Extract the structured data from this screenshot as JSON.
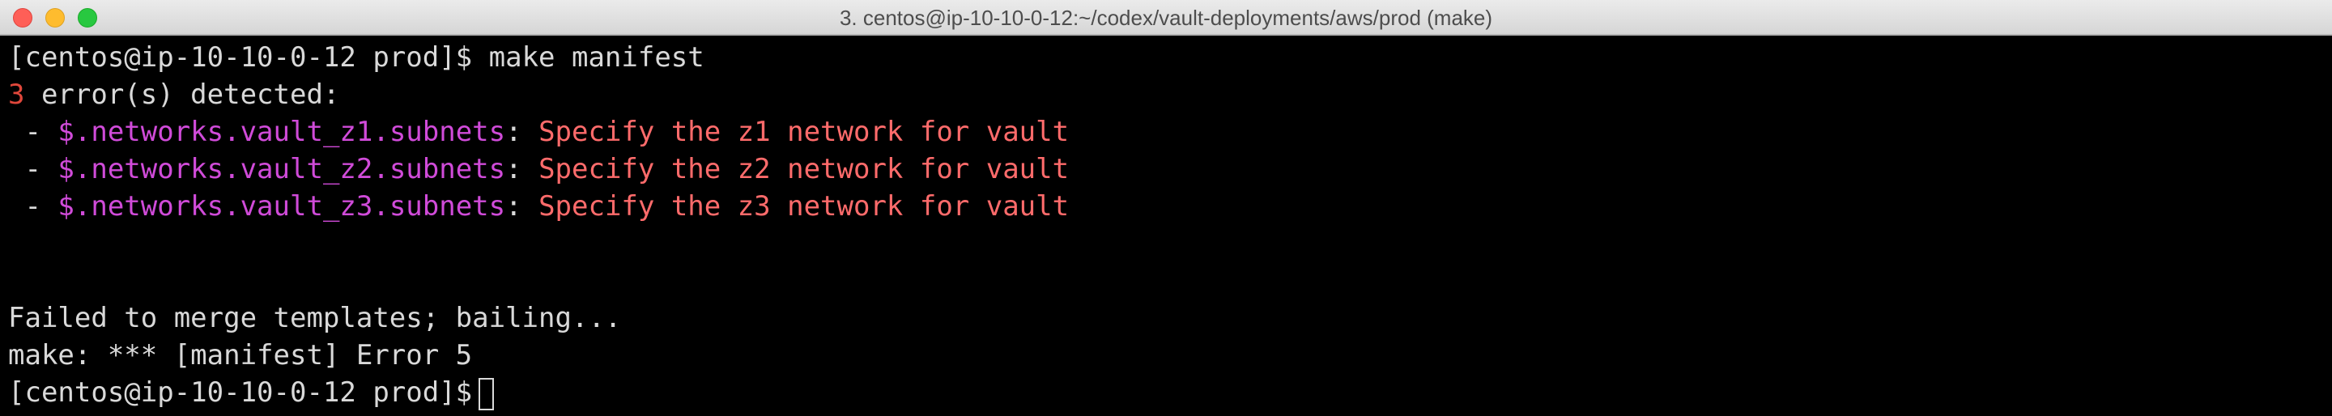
{
  "window": {
    "title": "3. centos@ip-10-10-0-12:~/codex/vault-deployments/aws/prod (make)"
  },
  "colors": {
    "error_count": "#e0473b",
    "path_key": "#d04bd9",
    "error_message": "#ff6b6b",
    "default_text": "#d9d9d9",
    "background": "#000000"
  },
  "terminal": {
    "prompt": "[centos@ip-10-10-0-12 prod]$",
    "command": "make manifest",
    "error_count": "3",
    "error_header_rest": " error(s) detected:",
    "error_bullet": " - ",
    "separator": ": ",
    "errors": [
      {
        "path": "$.networks.vault_z1.subnets",
        "message": "Specify the z1 network for vault"
      },
      {
        "path": "$.networks.vault_z2.subnets",
        "message": "Specify the z2 network for vault"
      },
      {
        "path": "$.networks.vault_z3.subnets",
        "message": "Specify the z3 network for vault"
      }
    ],
    "fail_line": "Failed to merge templates; bailing...",
    "make_error_line": "make: *** [manifest] Error 5",
    "final_prompt": "[centos@ip-10-10-0-12 prod]$"
  }
}
